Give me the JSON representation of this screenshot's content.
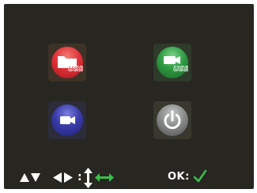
{
  "menu": {
    "items": [
      {
        "id": "usb-storage",
        "icon": "usb-folder-icon",
        "label": "USB",
        "color": "#e0323a"
      },
      {
        "id": "usb-camera",
        "icon": "usb-camera-icon",
        "label": "USB",
        "color": "#2f9a43"
      },
      {
        "id": "camera",
        "icon": "camera-icon",
        "color": "#3a3ca8"
      },
      {
        "id": "power",
        "icon": "power-icon",
        "color": "#8a8c8c"
      }
    ]
  },
  "hints": {
    "navigate_icons": [
      "up-arrow-icon",
      "down-arrow-icon",
      "left-arrow-icon",
      "right-arrow-icon"
    ],
    "colon": ":",
    "ok_label": "OK:",
    "ok_icon": "checkmark-icon",
    "accent": "#38c04a"
  }
}
